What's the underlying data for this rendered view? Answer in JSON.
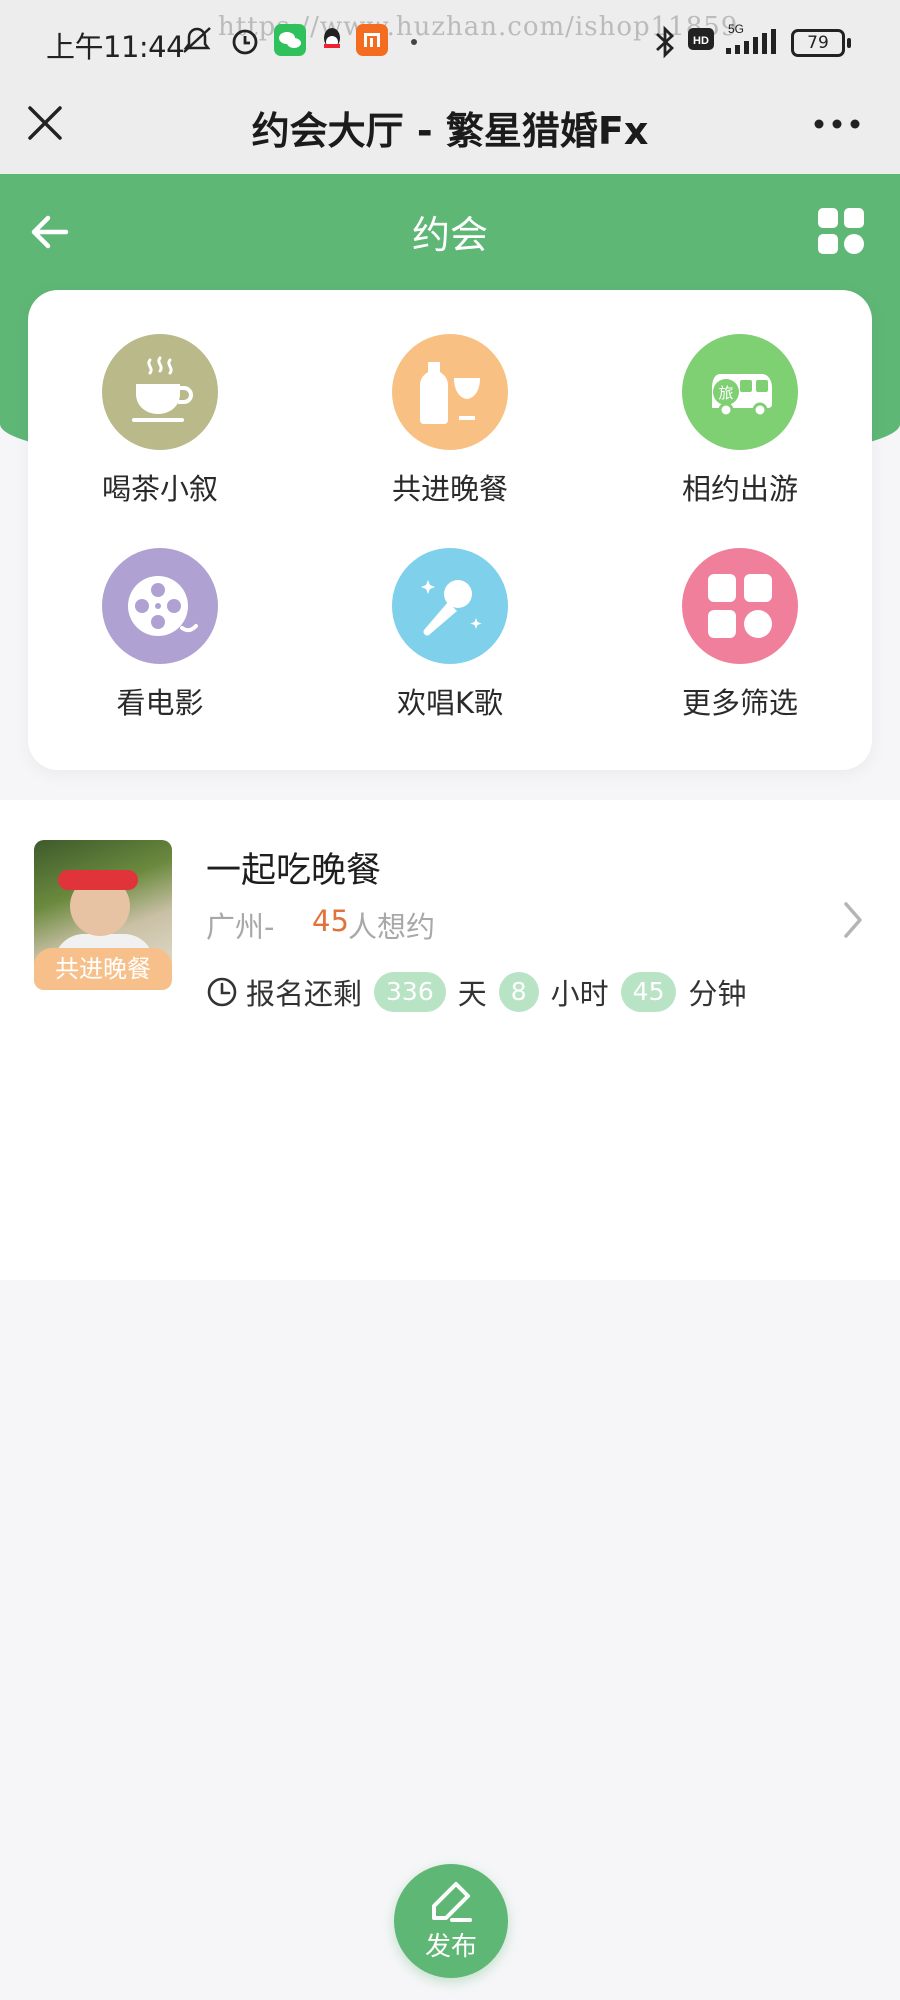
{
  "status_bar": {
    "time": "上午11:44",
    "watermark": "https://www.huzhan.com/ishop11859",
    "network": "5G",
    "hd_badge": "HD",
    "battery": "79"
  },
  "nav": {
    "title": "约会大厅 - 繁星猎婚Fx",
    "close_icon": "close-icon",
    "more_icon": "more-icon"
  },
  "header": {
    "title": "约会",
    "back_icon": "arrow-left-icon",
    "grid_icon": "grid-icon",
    "color": "#5fb776"
  },
  "categories": [
    {
      "label": "喝茶小叙",
      "icon": "tea-cup-icon",
      "color": "#b9b98a"
    },
    {
      "label": "共进晚餐",
      "icon": "wine-bottle-icon",
      "color": "#f9c083"
    },
    {
      "label": "相约出游",
      "icon": "tour-bus-icon",
      "color": "#7fcf73"
    },
    {
      "label": "看电影",
      "icon": "film-reel-icon",
      "color": "#b0a1d3"
    },
    {
      "label": "欢唱K歌",
      "icon": "microphone-icon",
      "color": "#7fd0ea"
    },
    {
      "label": "更多筛选",
      "icon": "grid-more-icon",
      "color": "#ef7f9a"
    }
  ],
  "dates": [
    {
      "title": "一起吃晚餐",
      "tag": "共进晚餐",
      "city": "广州-",
      "count": "45",
      "want_text": "人想约",
      "deadline_label": "报名还剩",
      "days": "336",
      "days_unit": "天",
      "hours": "8",
      "hours_unit": "小时",
      "minutes": "45",
      "minutes_unit": "分钟"
    }
  ],
  "fab": {
    "label": "发布",
    "icon": "pencil-icon"
  }
}
